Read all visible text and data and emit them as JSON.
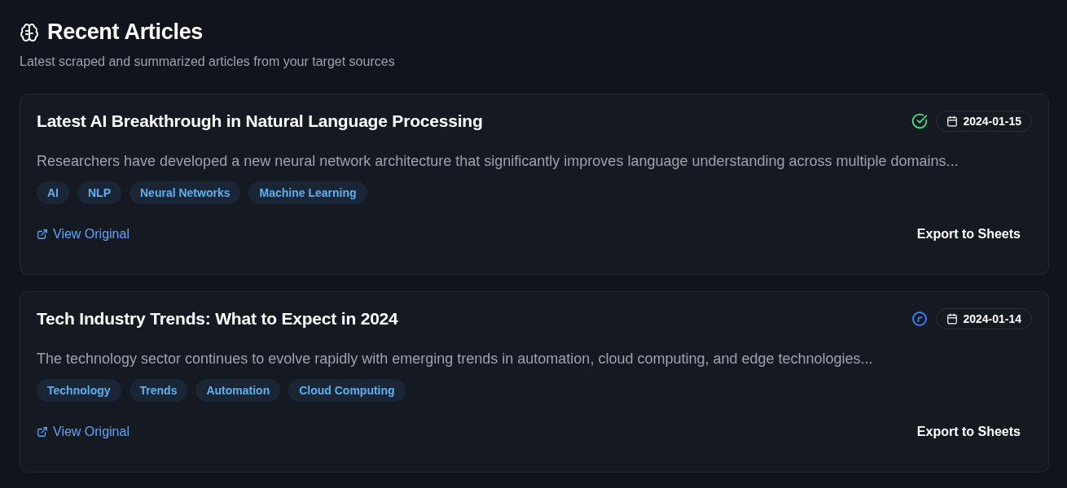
{
  "header": {
    "title": "Recent Articles",
    "subtitle": "Latest scraped and summarized articles from your target sources"
  },
  "articles": [
    {
      "title": "Latest AI Breakthrough in Natural Language Processing",
      "kind": "completed",
      "date": "2024-01-15",
      "summary": "Researchers have developed a new neural network architecture that significantly improves language understanding across multiple domains...",
      "tags": [
        "AI",
        "NLP",
        "Neural Networks",
        "Machine Learning"
      ],
      "link": "View Original",
      "action": "Export to Sheets"
    },
    {
      "title": "Tech Industry Trends: What to Expect in 2024",
      "kind": "processing",
      "date": "2024-01-14",
      "summary": "The technology sector continues to evolve rapidly with emerging trends in automation, cloud computing, and edge technologies...",
      "tags": [
        "Technology",
        "Trends",
        "Automation",
        "Cloud Computing"
      ],
      "link": "View Original",
      "action": "Export to Sheets"
    }
  ]
}
